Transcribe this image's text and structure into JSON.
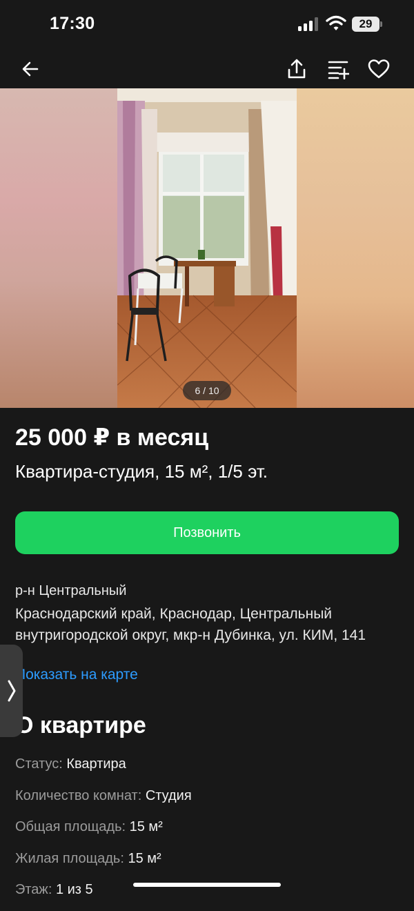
{
  "status_bar": {
    "time": "17:30",
    "battery": "29",
    "icons": [
      "signal-icon",
      "wifi-icon",
      "battery-icon"
    ]
  },
  "nav": {
    "icons": [
      "back-arrow-icon",
      "share-icon",
      "compare-icon",
      "favorite-heart-icon"
    ]
  },
  "gallery": {
    "counter": "6 / 10",
    "current": 6,
    "total": 10
  },
  "listing": {
    "price": "25 000 ₽ в месяц",
    "subtitle": "Квартира-студия, 15 м², 1/5 эт.",
    "call_button": "Позвонить",
    "district": "р-н Центральный",
    "address": "Краснодарский край, Краснодар, Центральный внутригородской округ, мкр-н Дубинка, ул. КИМ, 141",
    "map_link": "Показать на карте"
  },
  "about": {
    "title": "О квартире",
    "rows": [
      {
        "key": "Статус:",
        "value": "Квартира"
      },
      {
        "key": "Количество комнат:",
        "value": "Студия"
      },
      {
        "key": "Общая площадь:",
        "value": "15 м²"
      },
      {
        "key": "Жилая площадь:",
        "value": "15 м²"
      },
      {
        "key": "Этаж:",
        "value": "1 из 5"
      }
    ]
  },
  "colors": {
    "background": "#181818",
    "accent_green": "#1ed15f",
    "link_blue": "#2d9cff",
    "muted_text": "#9c9c9c"
  }
}
